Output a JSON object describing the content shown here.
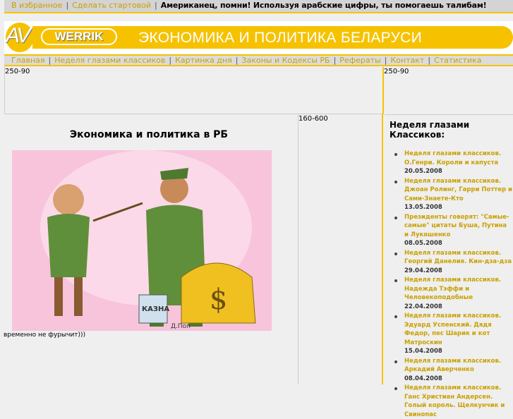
{
  "topbar": {
    "favorites": "В избранное",
    "homepage": "Сделать стартовой",
    "slogan": "Американец, помни! Используя арабские цифры, ты помогаешь талибам!"
  },
  "header": {
    "logo_av": "AV",
    "logo_werrik": "WERRIK",
    "title": "ЭКОНОМИКА И ПОЛИТИКА БЕЛАРУСИ"
  },
  "nav": [
    "Главная",
    "Неделя глазами классиков",
    "Картинка дня",
    "Законы и Кодексы РБ",
    "Рефераты",
    "Контакт",
    "Статистика"
  ],
  "ads": {
    "left": "250-90",
    "right": "250-90",
    "middle": "160-600"
  },
  "main": {
    "title": "Экономика и политика в РБ",
    "caption": "временно не фурычит)))",
    "cartoon_text": [
      "КАЗНА",
      "Д.Поп"
    ]
  },
  "sidebar": {
    "title": "Неделя глазами Классиков:",
    "items": [
      {
        "title": "Неделя глазами классиков. О.Генри. Короли и капуста",
        "date": "20.05.2008"
      },
      {
        "title": "Неделя глазами классиков. Джоан Ролинг, Гарри Поттер и Сами-Знаете-Кто",
        "date": "13.05.2008"
      },
      {
        "title": "Президенты говорят: \"Самые-самые\" цитаты Буша, Путина и Лукашенко",
        "date": "08.05.2008"
      },
      {
        "title": "Неделя глазами классиков. Георгий Данелия. Кин-дза-дза",
        "date": "29.04.2008"
      },
      {
        "title": "Неделя глазами классиков. Надежда Тэффи и Человекоподобные",
        "date": "22.04.2008"
      },
      {
        "title": "Неделя глазами классиков. Эдуард Успенский. Дядя Федор, пес Шарик и кот Матроскин",
        "date": "15.04.2008"
      },
      {
        "title": "Неделя глазами классиков. Аркадий Аверченко",
        "date": "08.04.2008"
      },
      {
        "title": "Неделя глазами классиков. Ганс Христиан Андерсен. Голый король. Щелкунчик и Свинопас",
        "date": ""
      }
    ]
  }
}
